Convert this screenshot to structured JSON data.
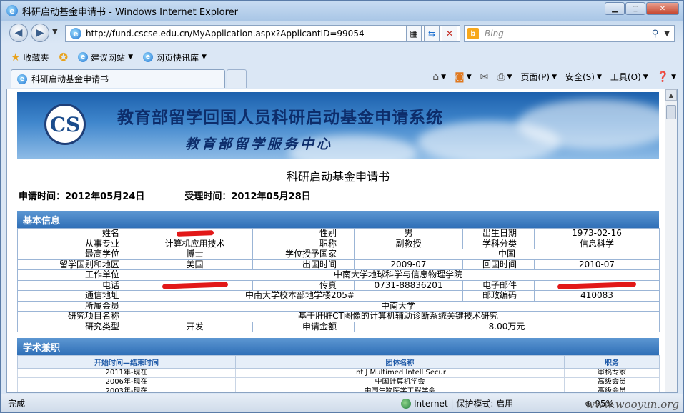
{
  "window": {
    "title": "科研启动基金申请书 - Windows Internet Explorer"
  },
  "address": {
    "url": "http://fund.cscse.edu.cn/MyApplication.aspx?ApplicantID=99054",
    "search_placeholder": "Bing"
  },
  "favorites": {
    "label": "收藏夹",
    "items": [
      "建议网站",
      "网页快讯库"
    ]
  },
  "tab": {
    "label": "科研启动基金申请书"
  },
  "commands": {
    "page": "页面(P)",
    "safety": "安全(S)",
    "tools": "工具(O)"
  },
  "banner": {
    "logo_text": "CS",
    "title": "教育部留学回国人员科研启动基金申请系统",
    "subtitle": "教育部留学服务中心"
  },
  "document": {
    "title": "科研启动基金申请书",
    "apply_time": "申请时间：2012年05月24日",
    "accept_time": "受理时间：2012年05月28日"
  },
  "basic": {
    "heading": "基本信息",
    "name_label": "姓名",
    "gender_label": "性别",
    "gender": "男",
    "birth_label": "出生日期",
    "birth": "1973-02-16",
    "major_label": "从事专业",
    "major": "计算机应用技术",
    "title_label": "职称",
    "title_value": "副教授",
    "subject_label": "学科分类",
    "subject": "信息科学",
    "degree_label": "最高学位",
    "degree": "博士",
    "degree_country_label": "学位授予国家",
    "degree_country": "中国",
    "study_country_label": "留学国别和地区",
    "study_country": "美国",
    "depart_label": "出国时间",
    "depart": "2009-07",
    "return_label": "回国时间",
    "return": "2010-07",
    "employer_label": "工作单位",
    "employer": "中南大学地球科学与信息物理学院",
    "phone_label": "电话",
    "fax_label": "传真",
    "fax": "0731-88836201",
    "email_label": "电子邮件",
    "address_label": "通信地址",
    "address": "中南大学校本部地学楼205#",
    "postcode_label": "邮政编码",
    "postcode": "410083",
    "member_label": "所属会员",
    "member": "中南大学",
    "project_label": "研究项目名称",
    "project": "基于肝脏CT图像的计算机辅助诊断系统关键技术研究",
    "type_label": "研究类型",
    "type": "开发",
    "amount_label": "申请金额",
    "amount": "8.00万元"
  },
  "academic": {
    "heading": "学术兼职",
    "headers": [
      "开始时间—结束时间",
      "团体名称",
      "职务"
    ],
    "rows": [
      [
        "2011年-现在",
        "Int J Multimed Intell Secur",
        "审稿专家"
      ],
      [
        "2006年-现在",
        "中国计算机学会",
        "高级会员"
      ],
      [
        "2003年-现在",
        "中国生物医学工程学会",
        "高级会员"
      ]
    ]
  },
  "status": {
    "done": "完成",
    "zone": "Internet | 保护模式: 启用",
    "zoom": "95%",
    "watermark": "www.wooyun.org"
  }
}
